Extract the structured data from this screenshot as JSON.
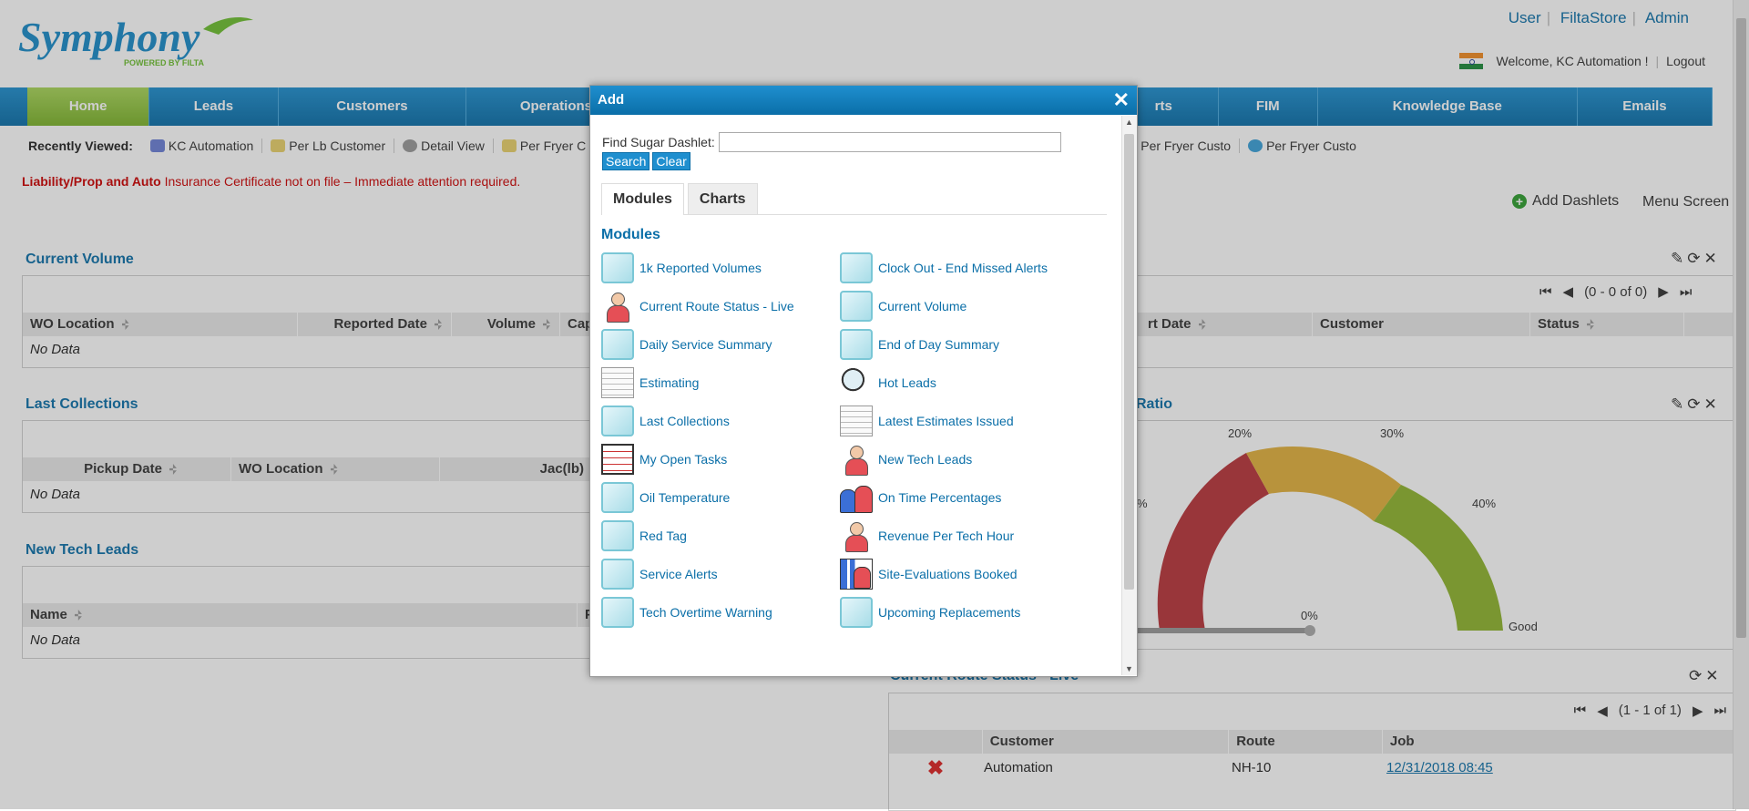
{
  "header": {
    "logo_text": "Symphony",
    "logo_sub": "POWERED BY FILTA",
    "top_links": [
      "User",
      "FiltaStore",
      "Admin"
    ],
    "welcome": "Welcome, KC Automation !",
    "logout": "Logout"
  },
  "nav": {
    "items": [
      "Home",
      "Leads",
      "Customers",
      "Operations",
      "Reports",
      "FIM",
      "Knowledge Base",
      "Emails"
    ],
    "visible_partial": [
      "Operatio",
      "rts"
    ]
  },
  "recent": {
    "label": "Recently Viewed:",
    "items": [
      "KC Automation",
      "Per Lb Customer",
      "Detail View",
      "Per Fryer C",
      "Per Fryer Custo",
      "Per Fryer Custo"
    ]
  },
  "notice": {
    "bold": "Liability/Prop and Auto",
    "text": " Insurance Certificate not on file – Immediate attention required."
  },
  "dashboard": {
    "add_dashlets": "Add Dashlets",
    "menu_screen": "Menu Screen",
    "current_volume": {
      "title": "Current Volume",
      "cols": [
        "WO Location",
        "Reported Date",
        "Volume",
        "Capa"
      ],
      "no_data": "No Data"
    },
    "last_collections": {
      "title": "Last Collections",
      "cols": [
        "Pickup Date",
        "WO Location",
        "Jac(lb)"
      ],
      "no_data": "No Data"
    },
    "new_tech_leads": {
      "title": "New Tech Leads",
      "cols": [
        "Name",
        "P"
      ],
      "no_data": "No Data"
    },
    "right_table": {
      "pagination": "(0 - 0 of 0)",
      "cols": [
        "rt Date",
        "Customer",
        "Status"
      ]
    },
    "gauge": {
      "title": "Ratio",
      "labels": [
        "%",
        "20%",
        "30%",
        "40%",
        "0%",
        "Good"
      ]
    },
    "route_status": {
      "title": "Current Route Status - Live",
      "pagination": "(1 - 1 of 1)",
      "cols": [
        "",
        "Customer",
        "Route",
        "Job"
      ],
      "row": {
        "customer": "Automation",
        "route": "NH-10",
        "job": "12/31/2018 08:45"
      }
    }
  },
  "modal": {
    "title": "Add",
    "find_label": "Find Sugar Dashlet:",
    "find_value": "",
    "search_btn": "Search",
    "clear_btn": "Clear",
    "tabs": [
      "Modules",
      "Charts"
    ],
    "section_title": "Modules",
    "left_items": [
      {
        "label": "1k Reported Volumes",
        "icon": "cube-icon"
      },
      {
        "label": "Current Route Status - Live",
        "icon": "person-icon"
      },
      {
        "label": "Daily Service Summary",
        "icon": "cube-icon"
      },
      {
        "label": "Estimating",
        "icon": "document-icon"
      },
      {
        "label": "Last Collections",
        "icon": "cube-icon"
      },
      {
        "label": "My Open Tasks",
        "icon": "tasks-icon"
      },
      {
        "label": "Oil Temperature",
        "icon": "cube-icon"
      },
      {
        "label": "Red Tag",
        "icon": "cube-icon"
      },
      {
        "label": "Service Alerts",
        "icon": "cube-icon"
      },
      {
        "label": "Tech Overtime Warning",
        "icon": "cube-icon"
      }
    ],
    "right_items": [
      {
        "label": "Clock Out - End Missed Alerts",
        "icon": "cube-icon"
      },
      {
        "label": "Current Volume",
        "icon": "cube-icon"
      },
      {
        "label": "End of Day Summary",
        "icon": "cube-icon"
      },
      {
        "label": "Hot Leads",
        "icon": "magnifier-icon"
      },
      {
        "label": "Latest Estimates Issued",
        "icon": "document-icon"
      },
      {
        "label": "New Tech Leads",
        "icon": "person-icon"
      },
      {
        "label": "On Time Percentages",
        "icon": "people-icon"
      },
      {
        "label": "Revenue Per Tech Hour",
        "icon": "person-icon"
      },
      {
        "label": "Site-Evaluations Booked",
        "icon": "chart-person-icon"
      },
      {
        "label": "Upcoming Replacements",
        "icon": "cube-icon"
      }
    ]
  }
}
